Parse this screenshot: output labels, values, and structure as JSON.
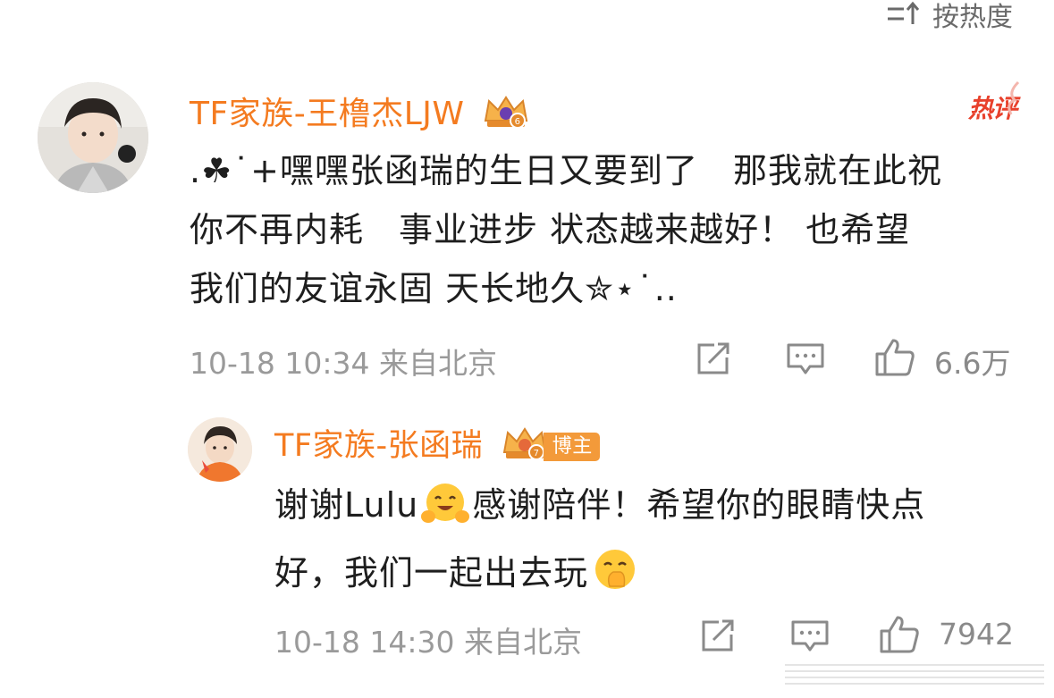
{
  "sort": {
    "label": "按热度"
  },
  "comment": {
    "username": "TF家族-王橹杰LJW",
    "hot_label": "热评",
    "text_lines": [
      ".☘˙+嘿嘿张函瑞的生日又要到了　那我就在此祝",
      "你不再内耗　事业进步 状态越来越好！ 也希望",
      "我们的友谊永固 天长地久✮⋆˙.."
    ],
    "meta": "10-18 10:34 来自北京",
    "like_count": "6.6万"
  },
  "reply": {
    "username": "TF家族-张函瑞",
    "badge_label": "博主",
    "text_line1_a": "谢谢Lulu",
    "text_line1_b": "感谢陪伴！希望你的眼睛快点",
    "text_line2": "好，我们一起出去玩",
    "meta": "10-18 14:30 来自北京",
    "like_count": "7942"
  },
  "colors": {
    "username": "#f47b20",
    "hot": "#e8412c",
    "meta": "#9a9a9a"
  },
  "icons": [
    "sort-icon",
    "crown-badge-icon",
    "hot-flare-icon",
    "repost-icon",
    "comment-icon",
    "like-icon",
    "hug-emoji-icon",
    "hand-over-mouth-emoji-icon"
  ]
}
